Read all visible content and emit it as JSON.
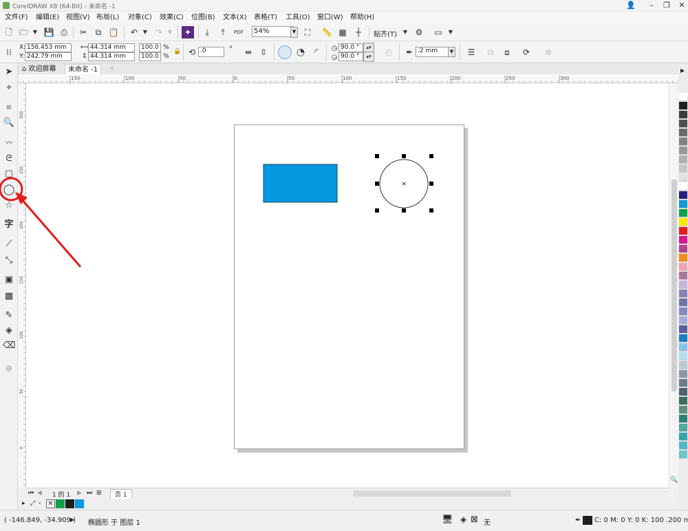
{
  "window": {
    "title": "CorelDRAW X8 (64-Bit) - 未命名 -1"
  },
  "menu": [
    "文件(F)",
    "编辑(E)",
    "视图(V)",
    "布局(L)",
    "对象(C)",
    "效果(C)",
    "位图(B)",
    "文本(X)",
    "表格(T)",
    "工具(O)",
    "窗口(W)",
    "帮助(H)"
  ],
  "toolbar": {
    "zoom": "54%",
    "snap_label": "贴齐(T)",
    "pdf_label": "PDF"
  },
  "property_bar": {
    "x_label": "X:",
    "x_value": "156.453 mm",
    "y_label": "Y:",
    "y_value": "242.79 mm",
    "w_value": "44.314 mm",
    "h_value": "44.314 mm",
    "scale_w": "100.0",
    "scale_h": "100.0",
    "percent": "%",
    "rotation": ".0",
    "degree": "°",
    "angle_start": "90.0 °",
    "angle_end": "90.0 °",
    "outline_width": ".2 mm"
  },
  "tabs": {
    "welcome": "欢迎屏幕",
    "document": "未命名 -1"
  },
  "ruler": {
    "top_labels": [
      "150",
      "100",
      "50",
      "0",
      "50",
      "100",
      "150",
      "200",
      "250",
      "300"
    ],
    "left_labels": [
      "300",
      "250",
      "200",
      "150",
      "100",
      "50",
      "0"
    ]
  },
  "page_nav": {
    "page_info": "1 的 1",
    "page_tab": "页 1"
  },
  "status": {
    "cursor_coords": "( -146.849, -34.909 )",
    "object_info": "椭圆形 于 图层 1",
    "fill_label": "无",
    "outline_info": "C: 0 M: 0 Y: 0 K: 100  .200 mm"
  },
  "colors": {
    "rect_fill": "#0499e1",
    "annotation": "#e41b1b",
    "palette": [
      "#ffffff",
      "#1e1e1e",
      "#3a3a3a",
      "#505050",
      "#6a6a6a",
      "#808080",
      "#989898",
      "#b0b0b0",
      "#c8c8c8",
      "#e0e0e0",
      "#ffffff",
      "#231f7a",
      "#1199d8",
      "#12a04a",
      "#ffe600",
      "#e21d22",
      "#d7188c",
      "#b5418d",
      "#f18e1c",
      "#f1a3b3",
      "#a8789c",
      "#c7b4d8",
      "#8f7fb9",
      "#6e74a9",
      "#7e8cc4",
      "#a2aed8",
      "#5c5c9a",
      "#1a7fc1",
      "#85c4ea",
      "#b7dcf2",
      "#bfc9d2",
      "#8c9aa7",
      "#6d7d8c",
      "#4f6272",
      "#3f6a5e",
      "#5d8f7d",
      "#2f7f75",
      "#4fa7a0",
      "#37a3a9",
      "#54b8c5",
      "#6cc7d1"
    ]
  }
}
